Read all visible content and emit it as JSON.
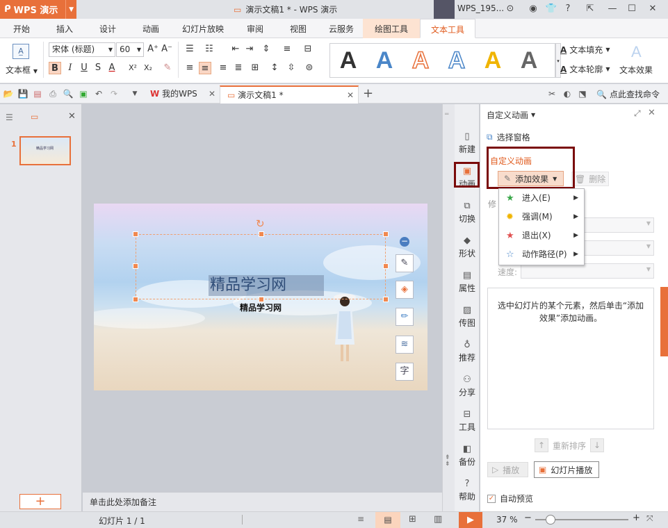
{
  "app": {
    "brand": "WPS 演示",
    "title": "演示文稿1 * - WPS 演示",
    "user": "WPS_195...",
    "help": "?"
  },
  "tabs": [
    "开始",
    "插入",
    "设计",
    "动画",
    "幻灯片放映",
    "审阅",
    "视图",
    "云服务",
    "绘图工具",
    "文本工具"
  ],
  "ribbon": {
    "textbox_label": "文本框",
    "font_name": "宋体 (标题)",
    "font_size": "60",
    "text_fill": "文本填充",
    "text_outline": "文本轮廓",
    "text_effect": "文本效果",
    "bold": "B",
    "italic": "I",
    "underline": "U",
    "strike": "S",
    "font_color": "A",
    "superscript": "X²",
    "subscript": "X₂",
    "grow": "A⁺",
    "shrink": "A⁻",
    "style_letters": [
      "A",
      "A",
      "A",
      "A",
      "A",
      "A"
    ],
    "style_colors": [
      "#111111",
      "#4a86c8",
      "#e8703a",
      "#4a86c8",
      "#f0b400",
      "#555555"
    ]
  },
  "quickbar": {
    "doc_tabs": [
      "我的WPS",
      "演示文稿1 *"
    ],
    "search": "点此查找命令",
    "add_tab": "+"
  },
  "leftpane": {
    "slide_number": "1",
    "thumb_text": "精品学习网",
    "add_slide": "+"
  },
  "slide": {
    "title": "精品学习网",
    "subtitle": "精品学习网"
  },
  "notes_placeholder": "单击此处添加备注",
  "tasks": [
    {
      "icon": "📄",
      "label": "新建"
    },
    {
      "icon": "🎞",
      "label": "动画"
    },
    {
      "icon": "⇄",
      "label": "切换"
    },
    {
      "icon": "◆",
      "label": "形状"
    },
    {
      "icon": "📋",
      "label": "属性"
    },
    {
      "icon": "🖼",
      "label": "传图"
    },
    {
      "icon": "👍",
      "label": "推荐"
    },
    {
      "icon": "👥",
      "label": "分享"
    },
    {
      "icon": "🧰",
      "label": "工具"
    },
    {
      "icon": "💾",
      "label": "备份"
    },
    {
      "icon": "?",
      "label": "帮助"
    }
  ],
  "panel": {
    "title": "自定义动画",
    "selection_pane": "选择窗格",
    "section_title": "自定义动画",
    "add_effect": "添加效果",
    "delete": "删除",
    "modify_prefix": "修",
    "speed_label": "速度:",
    "menu": [
      {
        "icon": "★",
        "label": "进入(E)",
        "color": "#3aa74a"
      },
      {
        "icon": "✹",
        "label": "强调(M)",
        "color": "#f0b400"
      },
      {
        "icon": "★",
        "label": "退出(X)",
        "color": "#e05050"
      },
      {
        "icon": "☆",
        "label": "动作路径(P)",
        "color": "#4a86c8"
      }
    ],
    "hint": "选中幻灯片的某个元素，然后单击“添加效果”添加动画。",
    "reorder": "重新排序",
    "play": "播放",
    "slideshow": "幻灯片播放",
    "auto_preview": "自动预览"
  },
  "status": {
    "slide_info": "幻灯片 1 / 1",
    "zoom": "37 %"
  }
}
